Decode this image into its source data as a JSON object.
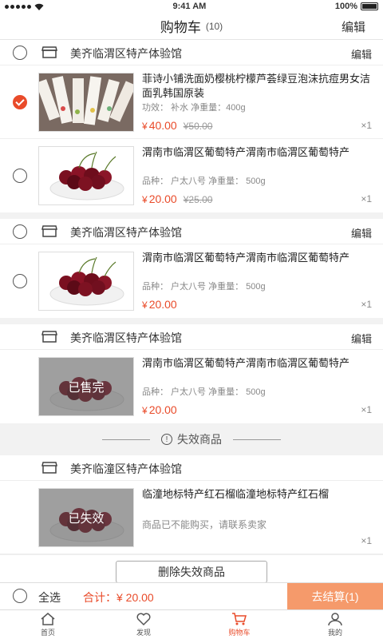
{
  "status": {
    "carrier": "",
    "time": "9:41 AM",
    "battery": "100%"
  },
  "nav": {
    "title": "购物车",
    "count": "(10)",
    "edit": "编辑"
  },
  "shops": [
    {
      "name": "美齐临渭区特产体验馆",
      "edit": "编辑",
      "items": [
        {
          "name": "菲诗小铺洗面奶樱桃柠檬芦荟绿豆泡沫抗痘男女洁面乳韩国原装",
          "spec": "功效： 补水   净重量：400g",
          "price": "40.00",
          "old_price": "¥50.00",
          "qty": "×1",
          "checked": true,
          "image": "cosmetics",
          "overlay": ""
        },
        {
          "name": "渭南市临渭区葡萄特产渭南市临渭区葡萄特产",
          "spec": "品种： 户太八号   净重量： 500g",
          "price": "20.00",
          "old_price": "¥25.00",
          "qty": "×1",
          "checked": false,
          "image": "cherries",
          "overlay": ""
        }
      ]
    },
    {
      "name": "美齐临渭区特产体验馆",
      "edit": "编辑",
      "items": [
        {
          "name": "渭南市临渭区葡萄特产渭南市临渭区葡萄特产",
          "spec": "品种： 户太八号   净重量： 500g",
          "price": "20.00",
          "old_price": "",
          "qty": "×1",
          "checked": false,
          "image": "cherries",
          "overlay": ""
        }
      ]
    },
    {
      "name": "美齐临渭区特产体验馆",
      "edit": "编辑",
      "items": [
        {
          "name": "渭南市临渭区葡萄特产渭南市临渭区葡萄特产",
          "spec": "品种： 户太八号   净重量： 500g",
          "price": "20.00",
          "old_price": "",
          "qty": "×1",
          "checked": null,
          "image": "cherries",
          "overlay": "已售完"
        }
      ]
    }
  ],
  "invalid": {
    "header": "失效商品",
    "shop_name": "美齐临潼区特产体验馆",
    "item": {
      "name": "临潼地标特产红石榴临潼地标特产红石榴",
      "note": "商品已不能购买，请联系卖家",
      "qty": "×1",
      "overlay": "已失效"
    },
    "delete_label": "删除失效商品"
  },
  "footer": {
    "select_all": "全选",
    "total_label": "合计：",
    "total_value": "¥ 20.00",
    "settle": "去结算(1)"
  },
  "tabs": [
    {
      "label": "首页",
      "icon": "home-icon",
      "active": false
    },
    {
      "label": "发现",
      "icon": "heart-icon",
      "active": false
    },
    {
      "label": "购物车",
      "icon": "cart-icon",
      "active": true
    },
    {
      "label": "我的",
      "icon": "user-icon",
      "active": false
    }
  ],
  "colors": {
    "accent": "#e94b2a",
    "settle_bg": "#f59a6b"
  }
}
